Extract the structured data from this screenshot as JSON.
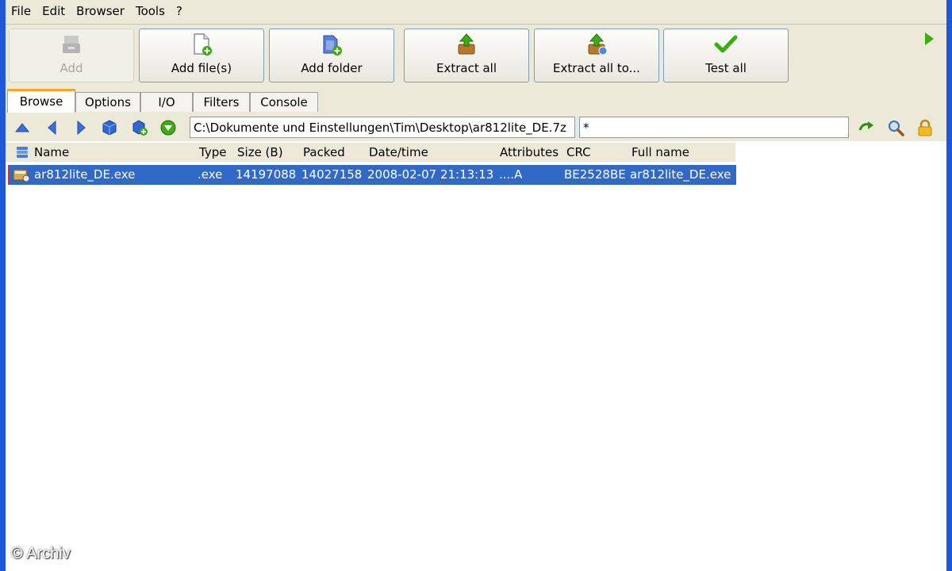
{
  "menu": [
    "File",
    "Edit",
    "Browser",
    "Tools",
    "?"
  ],
  "toolbar": {
    "buttons": [
      {
        "label": "Add",
        "icon": "add-archive-icon",
        "enabled": false
      },
      {
        "label": "Add file(s)",
        "icon": "add-file-icon",
        "enabled": true
      },
      {
        "label": "Add folder",
        "icon": "add-folder-icon",
        "enabled": true
      },
      {
        "label": "Extract all",
        "icon": "extract-icon",
        "enabled": true
      },
      {
        "label": "Extract all to...",
        "icon": "extract-to-icon",
        "enabled": true
      },
      {
        "label": "Test all",
        "icon": "checkmark-icon",
        "enabled": true
      }
    ]
  },
  "tabs": [
    "Browse",
    "Options",
    "I/O",
    "Filters",
    "Console"
  ],
  "active_tab": "Browse",
  "nav": {
    "path": "C:\\Dokumente und Einstellungen\\Tim\\Desktop\\ar812lite_DE.7z",
    "filter": "*"
  },
  "columns": [
    "Name",
    "Type",
    "Size (B)",
    "Packed",
    "Date/time",
    "Attributes",
    "CRC",
    "Full name"
  ],
  "rows": [
    {
      "name": "ar812lite_DE.exe",
      "type": ".exe",
      "size": "14197088",
      "packed": "14027158",
      "datetime": "2008-02-07 21:13:13",
      "attributes": "....A",
      "crc": "BE2528BE",
      "fullname": "ar812lite_DE.exe",
      "selected": true
    }
  ],
  "watermark": "© Archiv",
  "colors": {
    "selection": "#3169c6",
    "window_border": "#1e58d6",
    "active_tab_accent": "#f6a42b",
    "green": "#3dab12"
  }
}
